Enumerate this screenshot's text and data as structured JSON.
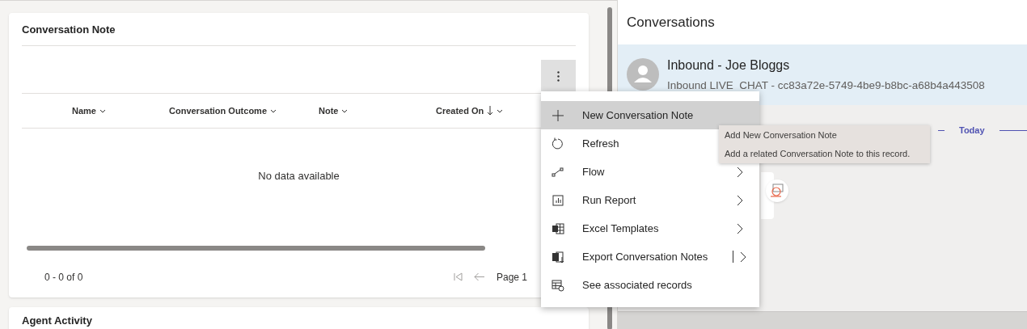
{
  "note_card": {
    "title": "Conversation Note",
    "columns": [
      {
        "label": "Name",
        "sorted": false
      },
      {
        "label": "Conversation Outcome",
        "sorted": false
      },
      {
        "label": "Note",
        "sorted": false
      },
      {
        "label": "Created On",
        "sorted": true
      }
    ],
    "empty_message": "No data available",
    "record_count": "0 - 0 of 0",
    "page_label": "Page 1"
  },
  "menu": [
    {
      "label": "New Conversation Note",
      "kind": "action",
      "selected": true
    },
    {
      "label": "Refresh",
      "kind": "action",
      "selected": false
    },
    {
      "label": "Flow",
      "kind": "submenu",
      "selected": false
    },
    {
      "label": "Run Report",
      "kind": "submenu",
      "selected": false
    },
    {
      "label": "Excel Templates",
      "kind": "submenu",
      "selected": false
    },
    {
      "label": "Export Conversation Notes",
      "kind": "split",
      "selected": false
    },
    {
      "label": "See associated records",
      "kind": "action",
      "selected": false
    }
  ],
  "tooltip": {
    "title": "Add New Conversation Note",
    "description": "Add a related Conversation Note to this record."
  },
  "agent_card": {
    "title": "Agent Activity"
  },
  "conversations": {
    "title": "Conversations",
    "items": [
      {
        "title": "Inbound - Joe Bloggs",
        "subtitle": "Inbound LIVE  CHAT - cc83a72e-5749-4be9-b8bc-a68b4a443508",
        "selected": true
      }
    ],
    "timeline_label": "Today"
  }
}
